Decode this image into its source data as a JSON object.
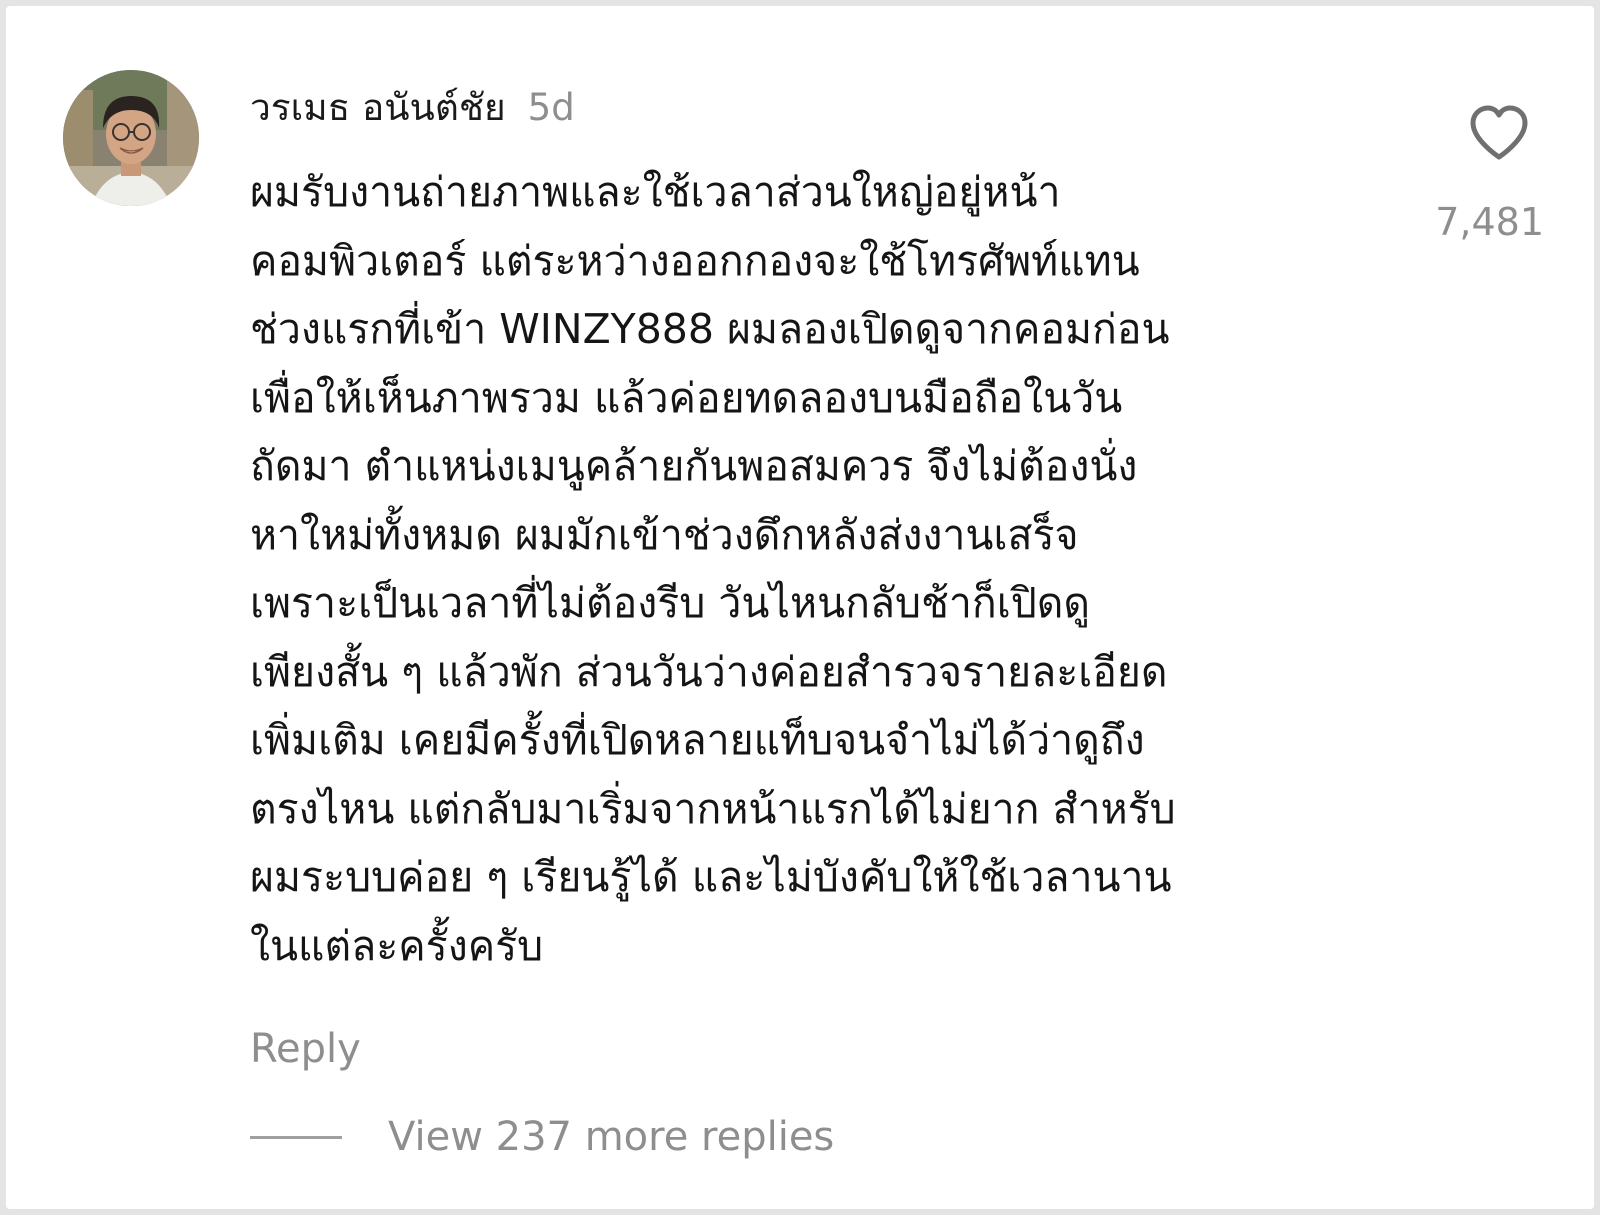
{
  "comment": {
    "username": "วรเมธ อนันต์ชัย",
    "timestamp": "5d",
    "text": "ผมรับงานถ่ายภาพและใช้เวลาส่วนใหญ่อยู่หน้า\nคอมพิวเตอร์ แต่ระหว่างออกกองจะใช้โทรศัพท์แทน\nช่วงแรกที่เข้า WINZY888 ผมลองเปิดดูจากคอมก่อน\nเพื่อให้เห็นภาพรวม แล้วค่อยทดลองบนมือถือในวัน\nถัดมา ตำแหน่งเมนูคล้ายกันพอสมควร จึงไม่ต้องนั่ง\nหาใหม่ทั้งหมด ผมมักเข้าช่วงดึกหลังส่งงานเสร็จ\nเพราะเป็นเวลาที่ไม่ต้องรีบ วันไหนกลับช้าก็เปิดดู\nเพียงสั้น ๆ แล้วพัก ส่วนวันว่างค่อยสำรวจรายละเอียด\nเพิ่มเติม เคยมีครั้งที่เปิดหลายแท็บจนจำไม่ได้ว่าดูถึง\nตรงไหน แต่กลับมาเริ่มจากหน้าแรกได้ไม่ยาก สำหรับ\nผมระบบค่อย ๆ เรียนรู้ได้ และไม่บังคับให้ใช้เวลานาน\nในแต่ละครั้งครับ",
    "reply_label": "Reply",
    "like_count": "7,481",
    "like_icon": "heart-outline-icon",
    "view_replies_label": "View 237 more replies"
  },
  "colors": {
    "text_primary": "#151515",
    "text_secondary": "#8e8e8e",
    "background": "#ffffff"
  }
}
